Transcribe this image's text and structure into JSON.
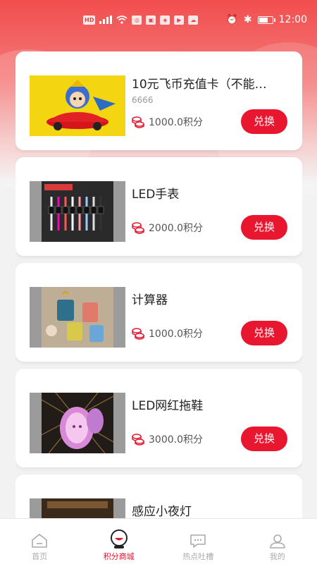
{
  "status_bar": {
    "left_chips": [
      "HD",
      "⁴G"
    ],
    "time": "12:00"
  },
  "products": [
    {
      "title": "10元飞币充值卡（不能…",
      "subtitle": "6666",
      "price": "1000.0积分",
      "button": "兑换"
    },
    {
      "title": "LED手表",
      "subtitle": "",
      "price": "2000.0积分",
      "button": "兑换"
    },
    {
      "title": "计算器",
      "subtitle": "",
      "price": "1000.0积分",
      "button": "兑换"
    },
    {
      "title": "LED网红拖鞋",
      "subtitle": "",
      "price": "3000.0积分",
      "button": "兑换"
    },
    {
      "title": "感应小夜灯",
      "subtitle": "",
      "price": "",
      "button": ""
    }
  ],
  "tabbar": {
    "items": [
      {
        "label": "首页",
        "icon": "home-icon",
        "active": false
      },
      {
        "label": "积分商城",
        "icon": "mall-icon",
        "active": true
      },
      {
        "label": "热点吐槽",
        "icon": "chat-icon",
        "active": false
      },
      {
        "label": "我的",
        "icon": "profile-icon",
        "active": false
      }
    ]
  },
  "colors": {
    "accent": "#e8172f",
    "header_gradient_top": "#f24e4e"
  }
}
